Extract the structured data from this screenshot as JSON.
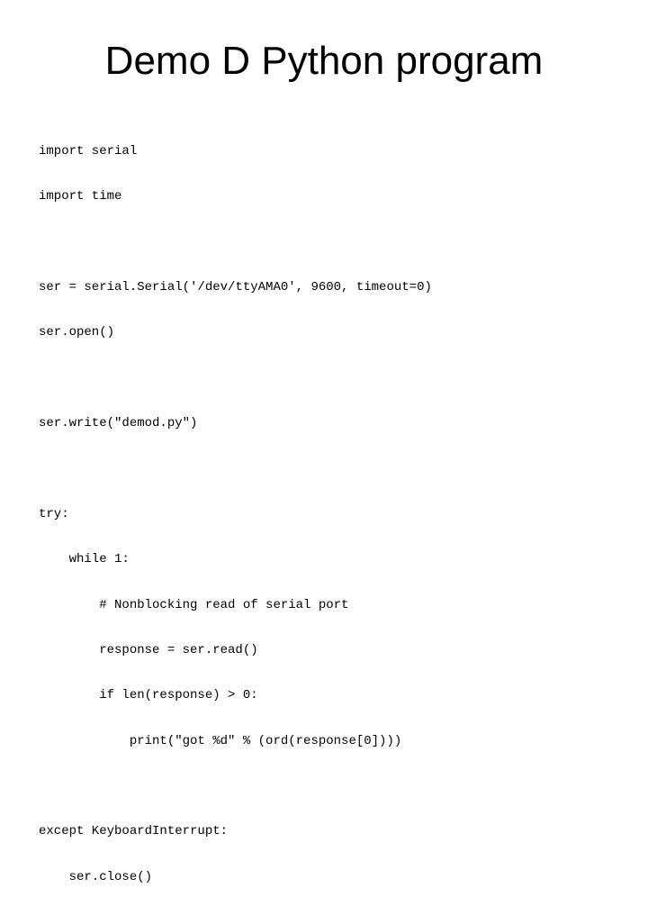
{
  "slide": {
    "title": "Demo D Python program",
    "code_lines": [
      "import serial",
      "import time",
      "",
      "ser = serial.Serial('/dev/ttyAMA0', 9600, timeout=0)",
      "ser.open()",
      "",
      "ser.write(\"demod.py\")",
      "",
      "try:",
      "    while 1:",
      "        # Nonblocking read of serial port",
      "        response = ser.read()",
      "        if len(response) > 0:",
      "            print(\"got %d\" % (ord(response[0])))",
      "",
      "except KeyboardInterrupt:",
      "    ser.close()"
    ]
  }
}
